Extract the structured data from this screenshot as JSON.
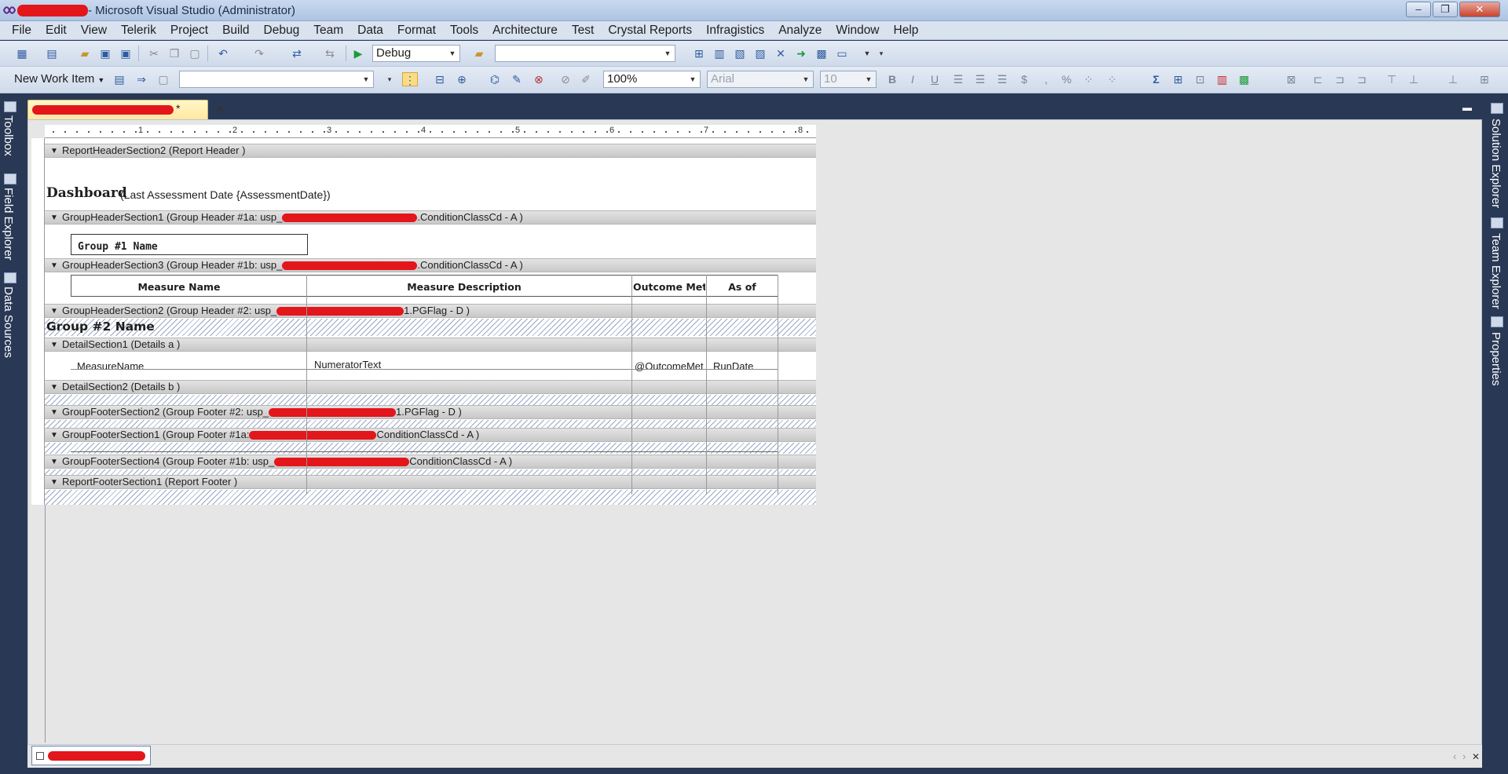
{
  "window": {
    "title": "- Microsoft Visual Studio (Administrator)",
    "minimize": "‒",
    "maximize": "❐",
    "close": "✕"
  },
  "menu": [
    "File",
    "Edit",
    "View",
    "Telerik",
    "Project",
    "Build",
    "Debug",
    "Team",
    "Data",
    "Format",
    "Tools",
    "Architecture",
    "Test",
    "Crystal Reports",
    "Infragistics",
    "Analyze",
    "Window",
    "Help"
  ],
  "toolbar1": {
    "config": "Debug",
    "platform": ""
  },
  "toolbar2": {
    "new_work_item": "New Work Item",
    "work_item_combo": "",
    "zoom": "100%",
    "font": "Arial",
    "font_size": "10",
    "bold": "B",
    "italic": "I",
    "underline": "U",
    "currency": "$",
    "comma": ",",
    "percent": "%",
    "sum": "Σ"
  },
  "left_rail": [
    "Toolbox",
    "Field Explorer",
    "Data Sources"
  ],
  "right_rail": [
    "Solution Explorer",
    "Team Explorer",
    "Properties"
  ],
  "doc_tab": {
    "title_suffix": "*",
    "close": "✕"
  },
  "ruler": [
    "1",
    "2",
    "3",
    "4",
    "5",
    "6",
    "7",
    "8"
  ],
  "sections": [
    {
      "label": "ReportHeaderSection2 (Report Header )"
    },
    {
      "label_a": "GroupHeaderSection1 (Group Header #1a: usp_",
      "label_b": ".ConditionClassCd - A )"
    },
    {
      "label_a": "GroupHeaderSection3 (Group Header #1b: usp_",
      "label_b": ".ConditionClassCd - A )"
    },
    {
      "label_a": "GroupHeaderSection2 (Group Header #2: usp_",
      "label_b": "1.PGFlag - D )"
    },
    {
      "label": "DetailSection1 (Details a )"
    },
    {
      "label": "DetailSection2 (Details b )"
    },
    {
      "label_a": "GroupFooterSection2 (Group Footer #2: usp_",
      "label_b": "1.PGFlag - D )"
    },
    {
      "label_a": "GroupFooterSection1 (Group Footer #1a:",
      "label_b": "ConditionClassCd - A )"
    },
    {
      "label_a": "GroupFooterSection4 (Group Footer #1b: usp_",
      "label_b": "ConditionClassCd - A )"
    },
    {
      "label": "ReportFooterSection1 (Report Footer )"
    }
  ],
  "report": {
    "title_bold": "Dashboard",
    "title_rest": "(Last Assessment Date {AssessmentDate})",
    "group1_name": "Group #1 Name",
    "col_measure_name": "Measure Name",
    "col_measure_desc": "Measure Description",
    "col_outcome": "Outcome Met",
    "col_as_of": "As of",
    "group2_name": "Group #2 Name",
    "field_measure_name": "MeasureName",
    "field_numerator": "NumeratorText",
    "field_outcome": "@OutcomeMet",
    "field_rundate": "RunDate"
  },
  "bottom_nav": {
    "prev": "‹",
    "next": "›",
    "close": "✕"
  },
  "colors": {
    "accent": "#293955",
    "redaction": "#e3161c",
    "tab": "#ffe9a0"
  }
}
